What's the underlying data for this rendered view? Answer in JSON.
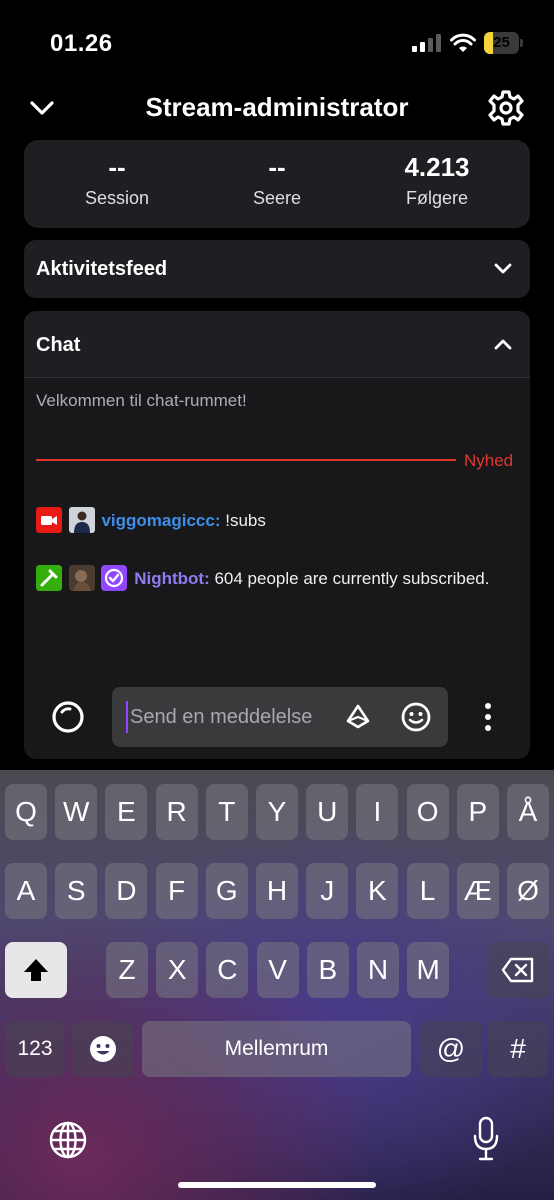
{
  "status_bar": {
    "time": "01.26",
    "battery": "25",
    "battery_percent": 25
  },
  "header": {
    "title": "Stream-administrator"
  },
  "stats": [
    {
      "value": "--",
      "label": "Session"
    },
    {
      "value": "--",
      "label": "Seere"
    },
    {
      "value": "4.213",
      "label": "Følgere"
    }
  ],
  "activity_feed": {
    "title": "Aktivitetsfeed"
  },
  "chat": {
    "title": "Chat",
    "welcome": "Velkommen til chat-rummet!",
    "divider_label": "Nyhed",
    "messages": [
      {
        "user": "viggomagiccc:",
        "text": " !subs",
        "user_color": "#3d8fe8"
      },
      {
        "user": "Nightbot:",
        "text": " 604 people are currently subscribed.",
        "user_color": "#8f7cf0"
      }
    ],
    "input_placeholder": "Send en meddelelse"
  },
  "keyboard": {
    "row1": [
      "Q",
      "W",
      "E",
      "R",
      "T",
      "Y",
      "U",
      "I",
      "O",
      "P",
      "Å"
    ],
    "row2": [
      "A",
      "S",
      "D",
      "F",
      "G",
      "H",
      "J",
      "K",
      "L",
      "Æ",
      "Ø"
    ],
    "row3": [
      "Z",
      "X",
      "C",
      "V",
      "B",
      "N",
      "M"
    ],
    "numbers_key": "123",
    "space_key": "Mellemrum",
    "at_key": "@",
    "hash_key": "#"
  }
}
